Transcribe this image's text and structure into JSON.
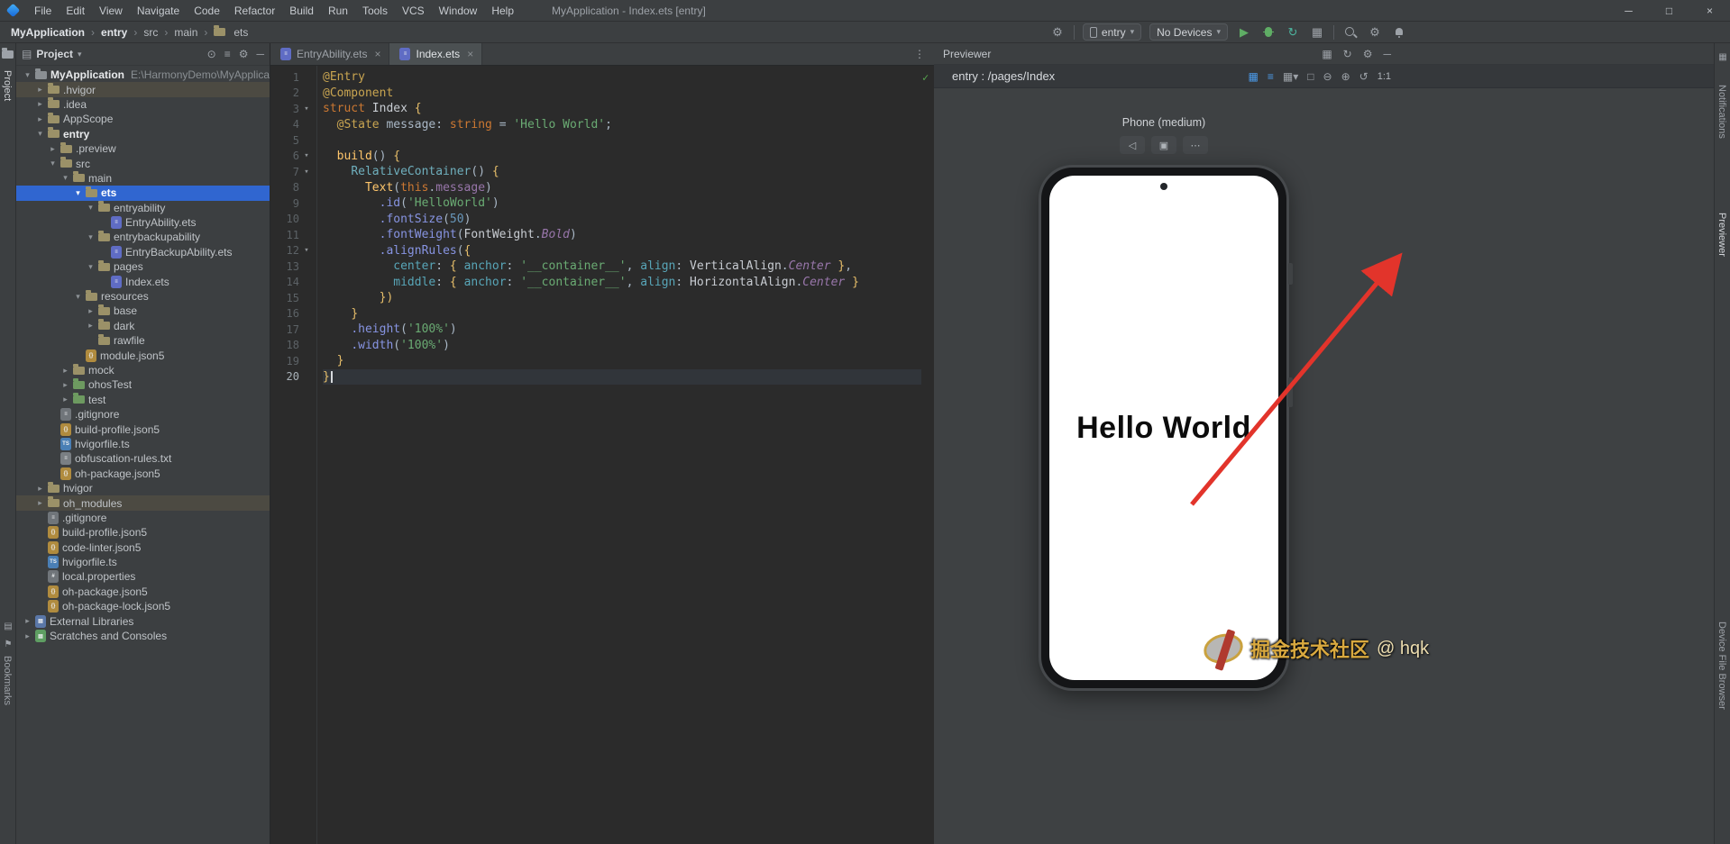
{
  "titlebar": {
    "menus": [
      "File",
      "Edit",
      "View",
      "Navigate",
      "Code",
      "Refactor",
      "Build",
      "Run",
      "Tools",
      "VCS",
      "Window",
      "Help"
    ],
    "title": "MyApplication - Index.ets [entry]",
    "window_controls": [
      "─",
      "□",
      "×"
    ]
  },
  "toolbar": {
    "breadcrumbs": [
      "MyApplication",
      "entry",
      "src",
      "main",
      "ets"
    ],
    "config_chip": "entry",
    "device_chip": "No Devices"
  },
  "left_strip": {
    "top_label": "Project",
    "bottom_label": "Bookmarks"
  },
  "right_strip": {
    "labels": [
      "Notifications",
      "Previewer"
    ],
    "bottom_label": "Device File Browser"
  },
  "project_panel": {
    "title": "Project",
    "tree": [
      {
        "label": "MyApplication",
        "extra": "E:\\HarmonyDemo\\MyApplication",
        "level": 0,
        "chev": "down",
        "icon": "project",
        "bold": true
      },
      {
        "label": ".hvigor",
        "level": 1,
        "chev": "right",
        "icon": "folder",
        "sel": "gray"
      },
      {
        "label": ".idea",
        "level": 1,
        "chev": "right",
        "icon": "folder"
      },
      {
        "label": "AppScope",
        "level": 1,
        "chev": "right",
        "icon": "folder"
      },
      {
        "label": "entry",
        "level": 1,
        "chev": "down",
        "icon": "module",
        "bold": true
      },
      {
        "label": ".preview",
        "level": 2,
        "chev": "right",
        "icon": "folder"
      },
      {
        "label": "src",
        "level": 2,
        "chev": "down",
        "icon": "folder"
      },
      {
        "label": "main",
        "level": 3,
        "chev": "down",
        "icon": "folder"
      },
      {
        "label": "ets",
        "level": 4,
        "chev": "down",
        "icon": "folder",
        "sel": "blue",
        "bold": true
      },
      {
        "label": "entryability",
        "level": 5,
        "chev": "down",
        "icon": "folder"
      },
      {
        "label": "EntryAbility.ets",
        "level": 6,
        "chev": "none",
        "icon": "ets"
      },
      {
        "label": "entrybackupability",
        "level": 5,
        "chev": "down",
        "icon": "folder"
      },
      {
        "label": "EntryBackupAbility.ets",
        "level": 6,
        "chev": "none",
        "icon": "ets"
      },
      {
        "label": "pages",
        "level": 5,
        "chev": "down",
        "icon": "folder"
      },
      {
        "label": "Index.ets",
        "level": 6,
        "chev": "none",
        "icon": "ets"
      },
      {
        "label": "resources",
        "level": 4,
        "chev": "down",
        "icon": "folder"
      },
      {
        "label": "base",
        "level": 5,
        "chev": "right",
        "icon": "folder"
      },
      {
        "label": "dark",
        "level": 5,
        "chev": "right",
        "icon": "folder"
      },
      {
        "label": "rawfile",
        "level": 5,
        "chev": "none",
        "icon": "folder"
      },
      {
        "label": "module.json5",
        "level": 4,
        "chev": "none",
        "icon": "json5"
      },
      {
        "label": "mock",
        "level": 3,
        "chev": "right",
        "icon": "folder"
      },
      {
        "label": "ohosTest",
        "level": 3,
        "chev": "right",
        "icon": "folder-test"
      },
      {
        "label": "test",
        "level": 3,
        "chev": "right",
        "icon": "folder-test"
      },
      {
        "label": ".gitignore",
        "level": 2,
        "chev": "none",
        "icon": "gitignore"
      },
      {
        "label": "build-profile.json5",
        "level": 2,
        "chev": "none",
        "icon": "json5"
      },
      {
        "label": "hvigorfile.ts",
        "level": 2,
        "chev": "none",
        "icon": "ts"
      },
      {
        "label": "obfuscation-rules.txt",
        "level": 2,
        "chev": "none",
        "icon": "txt"
      },
      {
        "label": "oh-package.json5",
        "level": 2,
        "chev": "none",
        "icon": "json5"
      },
      {
        "label": "hvigor",
        "level": 1,
        "chev": "right",
        "icon": "folder"
      },
      {
        "label": "oh_modules",
        "level": 1,
        "chev": "right",
        "icon": "folder",
        "sel": "gray"
      },
      {
        "label": ".gitignore",
        "level": 1,
        "chev": "none",
        "icon": "gitignore"
      },
      {
        "label": "build-profile.json5",
        "level": 1,
        "chev": "none",
        "icon": "json5"
      },
      {
        "label": "code-linter.json5",
        "level": 1,
        "chev": "none",
        "icon": "json5"
      },
      {
        "label": "hvigorfile.ts",
        "level": 1,
        "chev": "none",
        "icon": "ts"
      },
      {
        "label": "local.properties",
        "level": 1,
        "chev": "none",
        "icon": "props"
      },
      {
        "label": "oh-package.json5",
        "level": 1,
        "chev": "none",
        "icon": "json5"
      },
      {
        "label": "oh-package-lock.json5",
        "level": 1,
        "chev": "none",
        "icon": "json5"
      },
      {
        "label": "External Libraries",
        "level": 0,
        "chev": "right",
        "icon": "lib"
      },
      {
        "label": "Scratches and Consoles",
        "level": 0,
        "chev": "right",
        "icon": "scratch"
      }
    ]
  },
  "editor": {
    "tabs": [
      {
        "label": "EntryAbility.ets",
        "active": false
      },
      {
        "label": "Index.ets",
        "active": true
      }
    ],
    "active_line": 20,
    "folds": [
      3,
      6,
      7,
      12
    ],
    "lines": [
      [
        [
          "ann",
          "@Entry"
        ]
      ],
      [
        [
          "ann",
          "@Component"
        ]
      ],
      [
        [
          "kw",
          "struct "
        ],
        [
          "cls",
          "Index "
        ],
        [
          "brace",
          "{"
        ]
      ],
      [
        [
          "pl",
          "  "
        ],
        [
          "ann",
          "@State"
        ],
        [
          "pl",
          " message: "
        ],
        [
          "kw",
          "string"
        ],
        [
          "pl",
          " = "
        ],
        [
          "str",
          "'Hello World'"
        ],
        [
          "pl",
          ";"
        ]
      ],
      [],
      [
        [
          "pl",
          "  "
        ],
        [
          "fn",
          "build"
        ],
        [
          "pl",
          "() "
        ],
        [
          "brace",
          "{"
        ]
      ],
      [
        [
          "pl",
          "    "
        ],
        [
          "comp",
          "RelativeContainer"
        ],
        [
          "pl",
          "() "
        ],
        [
          "brace",
          "{"
        ]
      ],
      [
        [
          "pl",
          "      "
        ],
        [
          "fn",
          "Text"
        ],
        [
          "pl",
          "("
        ],
        [
          "kw",
          "this"
        ],
        [
          "pl",
          "."
        ],
        [
          "fld",
          "message"
        ],
        [
          "pl",
          ")"
        ]
      ],
      [
        [
          "pl",
          "        "
        ],
        [
          "mth",
          ".id"
        ],
        [
          "pl",
          "("
        ],
        [
          "str",
          "'HelloWorld'"
        ],
        [
          "pl",
          ")"
        ]
      ],
      [
        [
          "pl",
          "        "
        ],
        [
          "mth",
          ".fontSize"
        ],
        [
          "pl",
          "("
        ],
        [
          "num",
          "50"
        ],
        [
          "pl",
          ")"
        ]
      ],
      [
        [
          "pl",
          "        "
        ],
        [
          "mth",
          ".fontWeight"
        ],
        [
          "pl",
          "("
        ],
        [
          "cls",
          "FontWeight"
        ],
        [
          "pl",
          "."
        ],
        [
          "enum",
          "Bold"
        ],
        [
          "pl",
          ")"
        ]
      ],
      [
        [
          "pl",
          "        "
        ],
        [
          "mth",
          ".alignRules"
        ],
        [
          "pl",
          "("
        ],
        [
          "brace",
          "{"
        ]
      ],
      [
        [
          "pl",
          "          "
        ],
        [
          "prop",
          "center"
        ],
        [
          "pl",
          ": "
        ],
        [
          "brace",
          "{"
        ],
        [
          "pl",
          " "
        ],
        [
          "prop",
          "anchor"
        ],
        [
          "pl",
          ": "
        ],
        [
          "str",
          "'__container__'"
        ],
        [
          "pl",
          ", "
        ],
        [
          "prop",
          "align"
        ],
        [
          "pl",
          ": "
        ],
        [
          "cls",
          "VerticalAlign"
        ],
        [
          "pl",
          "."
        ],
        [
          "enum",
          "Center"
        ],
        [
          "pl",
          " "
        ],
        [
          "brace",
          "}"
        ],
        [
          "pl",
          ","
        ]
      ],
      [
        [
          "pl",
          "          "
        ],
        [
          "prop",
          "middle"
        ],
        [
          "pl",
          ": "
        ],
        [
          "brace",
          "{"
        ],
        [
          "pl",
          " "
        ],
        [
          "prop",
          "anchor"
        ],
        [
          "pl",
          ": "
        ],
        [
          "str",
          "'__container__'"
        ],
        [
          "pl",
          ", "
        ],
        [
          "prop",
          "align"
        ],
        [
          "pl",
          ": "
        ],
        [
          "cls",
          "HorizontalAlign"
        ],
        [
          "pl",
          "."
        ],
        [
          "enum",
          "Center"
        ],
        [
          "pl",
          " "
        ],
        [
          "brace",
          "}"
        ]
      ],
      [
        [
          "pl",
          "        "
        ],
        [
          "brace",
          "})"
        ]
      ],
      [
        [
          "pl",
          "    "
        ],
        [
          "brace",
          "}"
        ]
      ],
      [
        [
          "pl",
          "    "
        ],
        [
          "mth",
          ".height"
        ],
        [
          "pl",
          "("
        ],
        [
          "str",
          "'100%'"
        ],
        [
          "pl",
          ")"
        ]
      ],
      [
        [
          "pl",
          "    "
        ],
        [
          "mth",
          ".width"
        ],
        [
          "pl",
          "("
        ],
        [
          "str",
          "'100%'"
        ],
        [
          "pl",
          ")"
        ]
      ],
      [
        [
          "pl",
          "  "
        ],
        [
          "brace",
          "}"
        ]
      ],
      [
        [
          "brace",
          "}"
        ]
      ]
    ]
  },
  "previewer": {
    "title": "Previewer",
    "route": "entry : /pages/Index",
    "device_label": "Phone (medium)",
    "screen_text": "Hello World",
    "zoom_label": "1:1"
  },
  "watermark": {
    "text": "掘金技术社区",
    "handle": "@ hqk"
  },
  "colors": {
    "accent_blue": "#3066d0",
    "run_green": "#5fad65",
    "arrow_red": "#e2342b"
  }
}
